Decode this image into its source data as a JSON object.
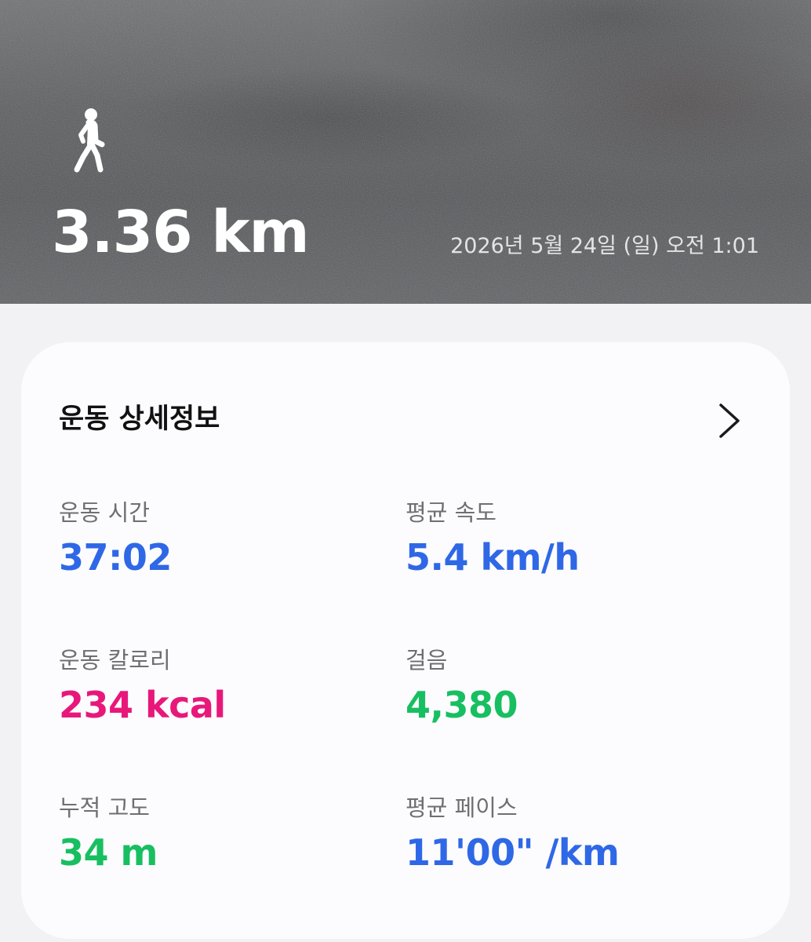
{
  "header": {
    "distance": "3.36 km",
    "datetime": "2026년 5월 24일 (일) 오전 1:01",
    "activity_icon": "walk-icon"
  },
  "details": {
    "title": "운동 상세정보",
    "chevron_icon": "chevron-right-icon",
    "stats": [
      {
        "label": "운동 시간",
        "value": "37:02",
        "color": "#2f68e6"
      },
      {
        "label": "평균 속도",
        "value": "5.4 km/h",
        "color": "#2f68e6"
      },
      {
        "label": "운동 칼로리",
        "value": "234 kcal",
        "color": "#e8187a"
      },
      {
        "label": "걸음",
        "value": "4,380",
        "color": "#18bf61"
      },
      {
        "label": "누적 고도",
        "value": "34 m",
        "color": "#18bf61"
      },
      {
        "label": "평균 페이스",
        "value": "11'00\" /km",
        "color": "#2f68e6"
      }
    ]
  },
  "colors": {
    "blue": "#2f68e6",
    "pink": "#e8187a",
    "green": "#18bf61",
    "card_bg": "#fcfcfe",
    "page_bg": "#f2f2f4"
  }
}
